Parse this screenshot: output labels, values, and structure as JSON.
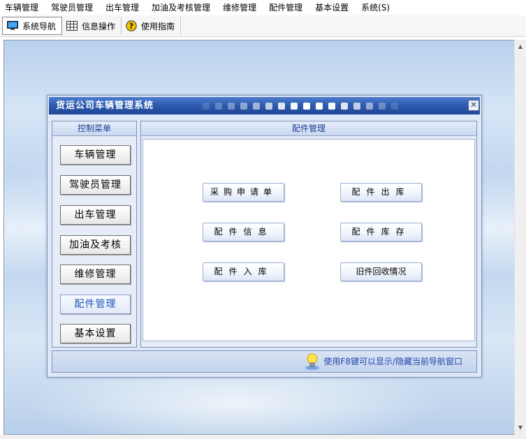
{
  "menubar": {
    "items": [
      "车辆管理",
      "驾驶员管理",
      "出车管理",
      "加油及考核管理",
      "维修管理",
      "配件管理",
      "基本设置",
      "系统(S)"
    ]
  },
  "toolbar": {
    "nav": {
      "label": "系统导航",
      "icon": "monitor-icon"
    },
    "info": {
      "label": "信息操作",
      "icon": "grid-icon"
    },
    "help": {
      "label": "使用指南",
      "icon": "help-icon"
    }
  },
  "dialog": {
    "title": "货运公司车辆管理系统",
    "left_header": "控制菜单",
    "right_header": "配件管理",
    "nav_buttons": [
      "车辆管理",
      "驾驶员管理",
      "出车管理",
      "加油及考核",
      "维修管理",
      "配件管理",
      "基本设置"
    ],
    "selected_nav": "配件管理",
    "functions": {
      "purchase": "采购申请单",
      "out": "配件出库",
      "info": "配件信息",
      "stock": "配件库存",
      "in": "配件入库",
      "recycle": "旧件回收情况"
    },
    "status_text": "使用F8键可以显示/隐藏当前导航窗口"
  },
  "colors": {
    "title_bar": "#2f5cb0",
    "accent_text": "#1f47a8",
    "selected_nav_text": "#2556b6"
  }
}
